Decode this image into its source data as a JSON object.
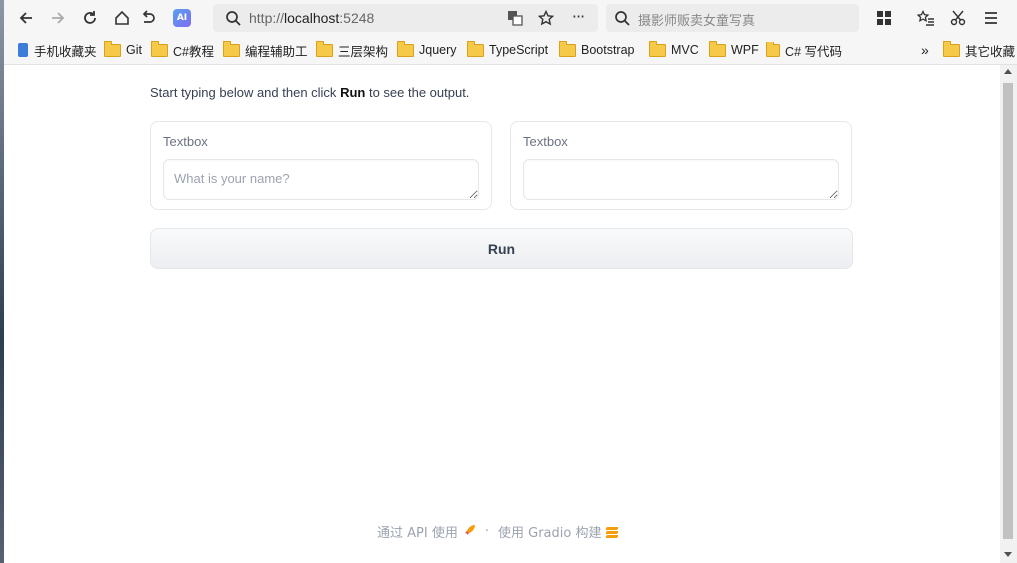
{
  "browser": {
    "url_prefix": "http://",
    "url_host": "localhost",
    "url_port": ":5248",
    "search_placeholder": "摄影师贩卖女童写真",
    "ai_badge": "AI"
  },
  "bookmarks": {
    "items": [
      {
        "label": "手机收藏夹"
      },
      {
        "label": "Git"
      },
      {
        "label": "C#教程"
      },
      {
        "label": "编程辅助工"
      },
      {
        "label": "三层架构"
      },
      {
        "label": "Jquery"
      },
      {
        "label": "TypeScript"
      },
      {
        "label": "Bootstrap"
      },
      {
        "label": "MVC"
      },
      {
        "label": "WPF"
      },
      {
        "label": "C# 写代码"
      }
    ],
    "more": "»",
    "other": "其它收藏"
  },
  "app": {
    "intro_before": "Start typing below and then click ",
    "intro_bold": "Run",
    "intro_after": " to see the output.",
    "input_box": {
      "label": "Textbox",
      "placeholder": "What is your name?",
      "value": ""
    },
    "output_box": {
      "label": "Textbox",
      "value": ""
    },
    "run_label": "Run"
  },
  "footer": {
    "api_text": "通过 API 使用",
    "separator": "·",
    "built_text": "使用 Gradio 构建"
  }
}
